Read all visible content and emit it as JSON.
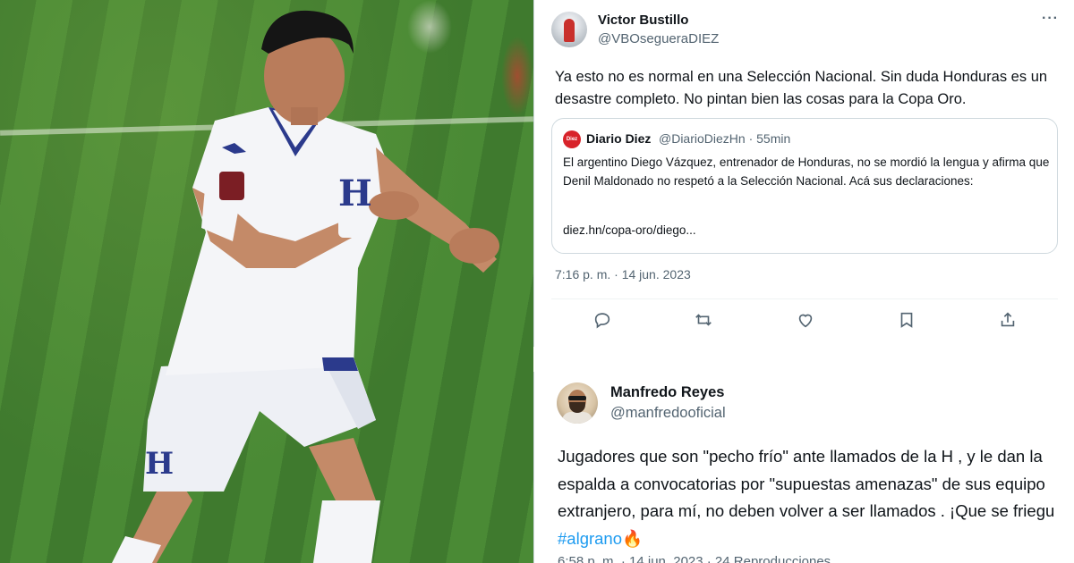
{
  "tweet1": {
    "name": "Victor Bustillo",
    "handle": "@VBOsegueraDIEZ",
    "text": "Ya esto no es normal en una Selección Nacional. Sin duda Honduras es un desastre completo. No pintan bien las cosas para la Copa Oro.",
    "more": "···",
    "quote": {
      "logo_text": "Diez",
      "name": "Diario Diez",
      "handle_time": "@DiarioDiezHn · 55min",
      "text": "El argentino Diego Vázquez, entrenador de Honduras, no se mordió la lengua y afirma que Denil Maldonado no respetó a la Selección Nacional. Acá sus declaraciones:",
      "link": "diez.hn/copa-oro/diego..."
    },
    "datetime": "7:16 p. m. · 14 jun. 2023",
    "actions": [
      {
        "icon": "reply-icon"
      },
      {
        "icon": "retweet-icon"
      },
      {
        "icon": "like-icon"
      },
      {
        "icon": "bookmark-icon"
      },
      {
        "icon": "share-icon"
      }
    ]
  },
  "tweet2": {
    "name": "Manfredo Reyes",
    "handle": "@manfredooficial",
    "lines": [
      "Jugadores que son \"pecho frío\" ante llamados de la H , y le dan la",
      "espalda a convocatorias por \"supuestas amenazas\" de sus equipo",
      "extranjero, para mí, no deben volver a ser llamados . ¡Que se friegu"
    ],
    "hashtag": "#algrano",
    "hashtag_emoji": "🔥",
    "meta": "6:58 p. m. · 14 jun. 2023 · 24 Reproducciones"
  },
  "photo": {
    "description_icon": "soccer-player-photo",
    "jersey_letter": "H",
    "colors": {
      "grass": "#3f7a2e",
      "kit": "#f4f5f8",
      "kit_accent": "#2b3a8c"
    }
  }
}
